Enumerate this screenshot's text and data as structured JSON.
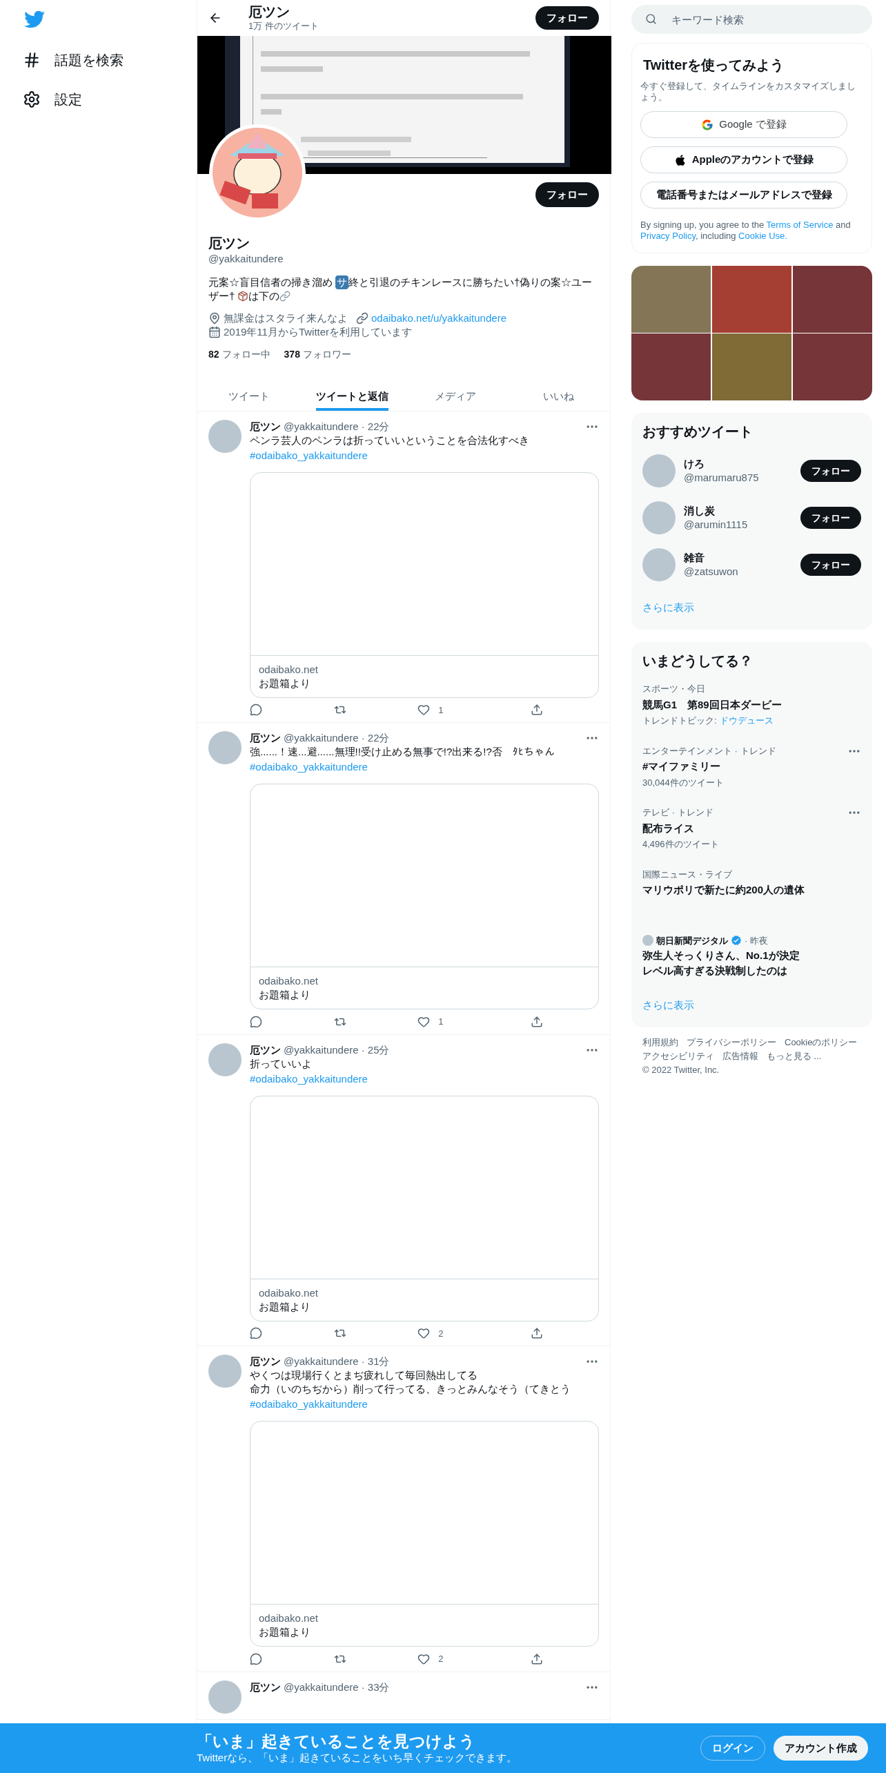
{
  "nav": {
    "items": [
      {
        "kind": "hash",
        "label": "話題を検索"
      },
      {
        "kind": "gear",
        "label": "設定"
      }
    ]
  },
  "header": {
    "title": "厄ツン",
    "subtitle": "1万 件のツイート",
    "follow": "フォロー"
  },
  "profile": {
    "follow": "フォロー",
    "name": "厄ツン",
    "handle": "@yakkaitundere",
    "bio": {
      "before": "元案☆盲目信者の掃き溜め",
      "badge": "サ",
      "after": [
        "終と引退のチキンレースに勝ちたい†偽りの案☆ユー",
        "ザー†"
      ],
      "tail": "は下の"
    },
    "location": "無課金はスタライ来んなよ",
    "url": "odaibako.net/u/yakkaitundere",
    "joined": "2019年11月からTwitterを利用しています",
    "following_count": "82",
    "following_label": "フォロー中",
    "followers_count": "378",
    "followers_label": "フォロワー"
  },
  "tabs": [
    {
      "label": "ツイート",
      "selected": false
    },
    {
      "label": "ツイートと返信",
      "selected": true
    },
    {
      "label": "メディア",
      "selected": false
    },
    {
      "label": "いいね",
      "selected": false
    }
  ],
  "tweets": [
    {
      "name": "厄ツン",
      "handle": "@yakkaitundere",
      "time": "· 22分",
      "lines": [
        "ペンラ芸人のペンラは折っていいということを合法化すべき"
      ],
      "hashtag": "#odaibako_yakkaitundere",
      "card": {
        "domain": "odaibako.net",
        "title": "お題箱より"
      },
      "likes": "1"
    },
    {
      "name": "厄ツン",
      "handle": "@yakkaitundere",
      "time": "· 22分",
      "lines": [
        "強......！速...避......無理!!受け止める無事で!?出来る!?否　ﾀﾋちゃん"
      ],
      "hashtag": "#odaibako_yakkaitundere",
      "card": {
        "domain": "odaibako.net",
        "title": "お題箱より"
      },
      "likes": "1"
    },
    {
      "name": "厄ツン",
      "handle": "@yakkaitundere",
      "time": "· 25分",
      "lines": [
        "折っていいよ"
      ],
      "hashtag": "#odaibako_yakkaitundere",
      "card": {
        "domain": "odaibako.net",
        "title": "お題箱より"
      },
      "likes": "2"
    },
    {
      "name": "厄ツン",
      "handle": "@yakkaitundere",
      "time": "· 31分",
      "lines": [
        "やくつは現場行くとまぢ疲れして毎回熱出してる",
        "命力（いのちぢから）削って行ってる、きっとみんなそう（てきとう"
      ],
      "hashtag": "#odaibako_yakkaitundere",
      "card": {
        "domain": "odaibako.net",
        "title": "お題箱より"
      },
      "likes": "2"
    },
    {
      "name": "厄ツン",
      "handle": "@yakkaitundere",
      "time": "· 33分"
    }
  ],
  "search": {
    "placeholder": "キーワード検索"
  },
  "signup": {
    "title": "Twitterを使ってみよう",
    "subtitle": "今すぐ登録して、タイムラインをカスタマイズしましょう。",
    "buttons": [
      {
        "kind": "google",
        "label": "Google で登録"
      },
      {
        "kind": "apple",
        "label": "Appleのアカウントで登録"
      },
      {
        "kind": "plain",
        "label": "電話番号またはメールアドレスで登録"
      }
    ],
    "legal": [
      {
        "text": "By signing up, you agree to the ",
        "link": false
      },
      {
        "text": "Terms of Service",
        "link": true
      },
      {
        "text": " and ",
        "link": false
      },
      {
        "text": "Privacy Policy",
        "link": true
      },
      {
        "text": ", including ",
        "link": false
      },
      {
        "text": "Cookie Use.",
        "link": true
      }
    ]
  },
  "who_to_follow": {
    "title": "おすすめツイート",
    "users": [
      {
        "name": "けろ",
        "handle": "@marumaru875",
        "button": "フォロー"
      },
      {
        "name": "消し炭",
        "handle": "@arumin1115",
        "button": "フォロー"
      },
      {
        "name": "雑音",
        "handle": "@zatsuwon",
        "button": "フォロー"
      }
    ],
    "more": "さらに表示"
  },
  "trends": {
    "title": "いまどうしてる？",
    "items": [
      {
        "kind": "topic",
        "context": "スポーツ・今日",
        "title": "競馬G1　第89回日本ダービー",
        "topic_label": "トレンドトピック:",
        "topic": "ドウデュース"
      },
      {
        "kind": "trend",
        "context": "エンターテインメント · トレンド",
        "title": "#マイファミリー",
        "count": "30,044件のツイート"
      },
      {
        "kind": "trend",
        "context": "テレビ · トレンド",
        "title": "配布ライス",
        "count": "4,496件のツイート"
      },
      {
        "kind": "news",
        "context": "国際ニュース・ライブ",
        "title": "マリウポリで新たに約200人の遺体"
      },
      {
        "kind": "article",
        "source": "朝日新聞デジタル",
        "time": "· 昨夜",
        "lines": [
          "弥生人そっくりさん、No.1が決定",
          "レベル高すぎる決戦制したのは"
        ]
      }
    ],
    "more": "さらに表示"
  },
  "footer": {
    "links": [
      "利用規約",
      "プライバシーポリシー",
      "Cookieのポリシー",
      "アクセシビリティ",
      "広告情報",
      "もっと見る ..."
    ],
    "copyright": "© 2022 Twitter, Inc."
  },
  "bottom_bar": {
    "title": "「いま」起きていることを見つけよう",
    "subtitle": "Twitterなら、「いま」起きていることをいち早くチェックできます。",
    "login": "ログイン",
    "signup": "アカウント作成"
  }
}
